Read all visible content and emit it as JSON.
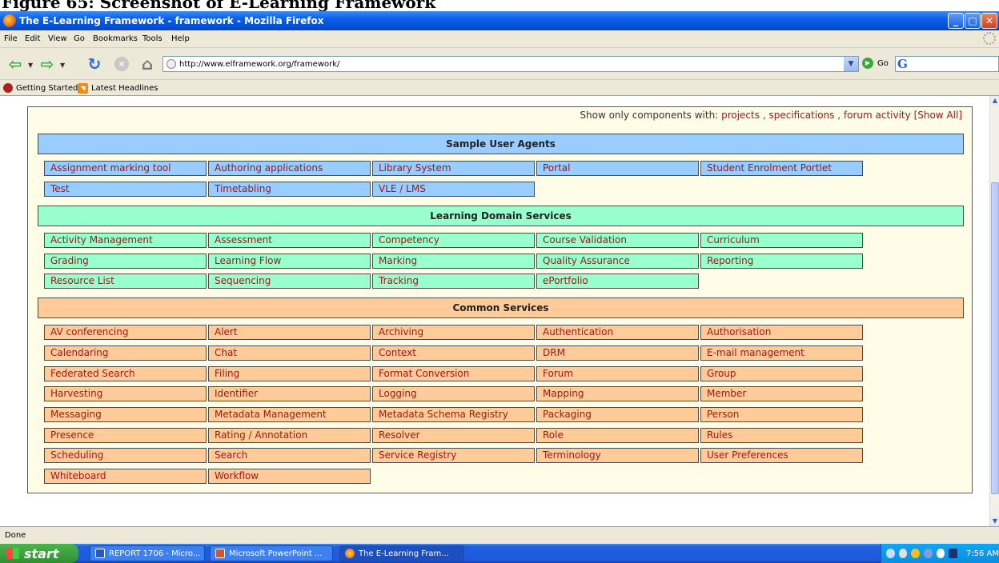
{
  "figure_caption": "Figure 65: Screenshot of E-Learning Framework",
  "window": {
    "title": "The E-Learning Framework - framework - Mozilla Firefox"
  },
  "menu": [
    "File",
    "Edit",
    "View",
    "Go",
    "Bookmarks",
    "Tools",
    "Help"
  ],
  "navigation": {
    "url": "http://www.elframework.org/framework/",
    "go_label": "Go",
    "google_glyph": "G"
  },
  "bookmarks": [
    "Getting Started",
    "Latest Headlines"
  ],
  "filter": {
    "prefix": "Show only components with:",
    "links": [
      "projects",
      "specifications",
      "forum activity"
    ],
    "separator": ",",
    "show_all": "[Show All]"
  },
  "sections": [
    {
      "title": "Sample User Agents",
      "color": "#99ccff",
      "items": [
        "Assignment marking tool",
        "Authoring applications",
        "Library System",
        "Portal",
        "Student Enrolment Portlet",
        "Test",
        "Timetabling",
        "VLE / LMS"
      ]
    },
    {
      "title": "Learning Domain Services",
      "color": "#99ffcc",
      "items": [
        "Activity Management",
        "Assessment",
        "Competency",
        "Course Validation",
        "Curriculum",
        "Grading",
        "Learning Flow",
        "Marking",
        "Quality Assurance",
        "Reporting",
        "Resource List",
        "Sequencing",
        "Tracking",
        "ePortfolio"
      ]
    },
    {
      "title": "Common Services",
      "color": "#ffcc99",
      "items": [
        "AV conferencing",
        "Alert",
        "Archiving",
        "Authentication",
        "Authorisation",
        "Calendaring",
        "Chat",
        "Context",
        "DRM",
        "E-mail management",
        "Federated Search",
        "Filing",
        "Format Conversion",
        "Forum",
        "Group",
        "Harvesting",
        "Identifier",
        "Logging",
        "Mapping",
        "Member",
        "Messaging",
        "Metadata Management",
        "Metadata Schema Registry",
        "Packaging",
        "Person",
        "Presence",
        "Rating / Annotation",
        "Resolver",
        "Role",
        "Rules",
        "Scheduling",
        "Search",
        "Service Registry",
        "Terminology",
        "User Preferences",
        "Whiteboard",
        "Workflow"
      ]
    }
  ],
  "status": "Done",
  "taskbar": {
    "start_label": "start",
    "tasks": [
      "REPORT 1706 - Micro...",
      "Microsoft PowerPoint ...",
      "The E-Learning Fram..."
    ],
    "clock": "7:56 AM"
  }
}
